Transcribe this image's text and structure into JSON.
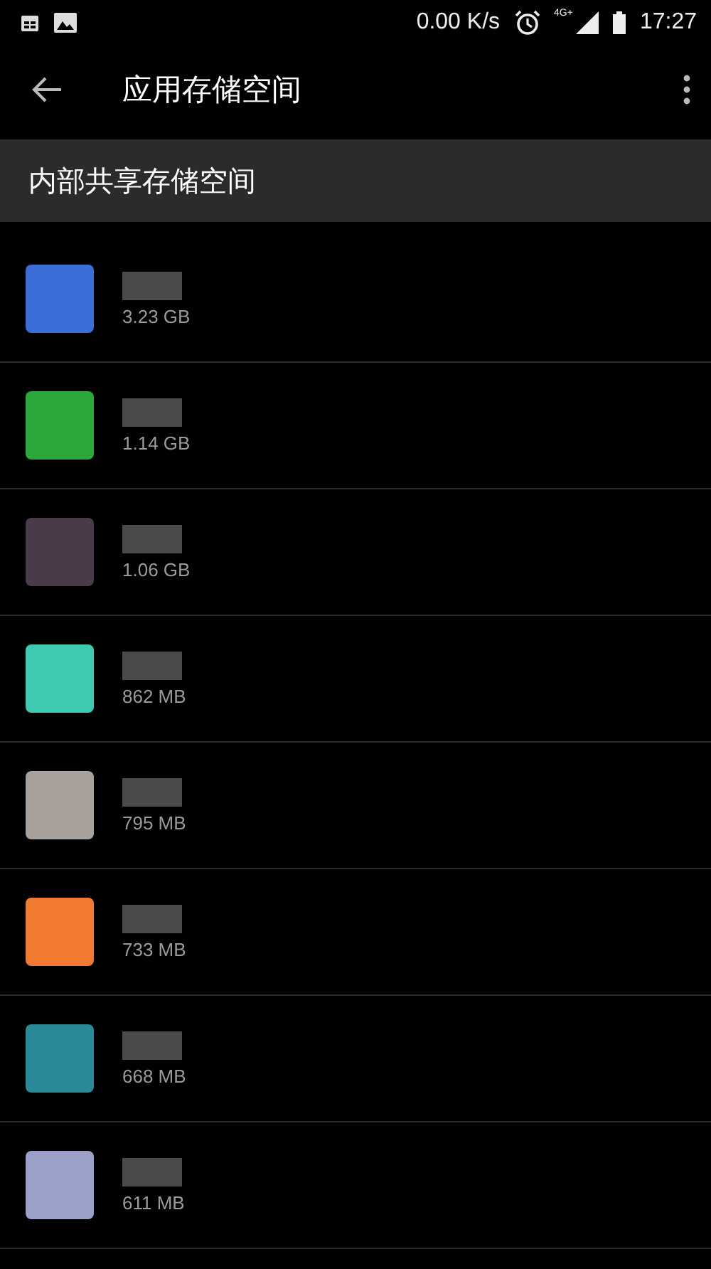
{
  "status_bar": {
    "speed": "0.00 K/s",
    "network": "4G+",
    "time": "17:27"
  },
  "toolbar": {
    "title": "应用存储空间"
  },
  "section": {
    "title": "内部共享存储空间"
  },
  "apps": [
    {
      "size": "3.23 GB",
      "color": "#3a6fd8"
    },
    {
      "size": "1.14 GB",
      "color": "#2aa83a"
    },
    {
      "size": "1.06 GB",
      "color": "#4a3a4a"
    },
    {
      "size": "862 MB",
      "color": "#3fc9b0"
    },
    {
      "size": "795 MB",
      "color": "#a8a09a"
    },
    {
      "size": "733 MB",
      "color": "#f07a30"
    },
    {
      "size": "668 MB",
      "color": "#2a8a9a"
    },
    {
      "size": "611 MB",
      "color": "#9aa0c8"
    }
  ]
}
